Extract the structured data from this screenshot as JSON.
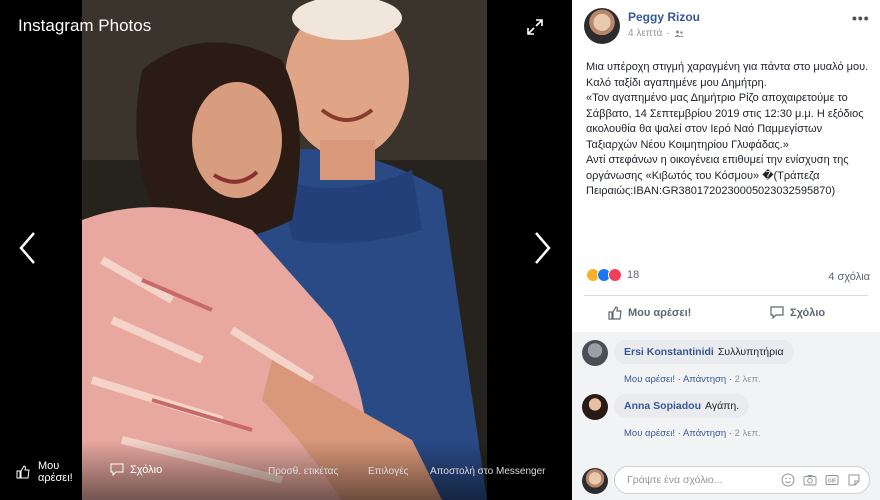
{
  "viewer": {
    "title": "Instagram Photos",
    "bottom": {
      "like_label": "Μου αρέσει!",
      "comment_label": "Σχόλιο",
      "links": [
        "Προσθ. ετικέτας",
        "Επιλογές",
        "Αποστολή στο Messenger"
      ]
    }
  },
  "post": {
    "author": "Peggy Rizou",
    "time": "4 λεπτά",
    "text_lines": [
      "Μια υπέροχη στιγμή χαραγμένη για πάντα στο μυαλό μου.",
      "Καλό ταξίδι αγαπημένε μου Δημήτρη.",
      "«Τον αγαπημένο μας Δημήτριο Ρίζο αποχαιρετούμε το Σάββατο, 14 Σεπτεμβρίου 2019 στις 12:30 μ.μ. Η εξόδιος ακολουθία θα ψαλεί στον Ιερό Ναό Παμμεγίστων Ταξιαρχών Νέου Κοιμητηρίου Γλυφάδας.»",
      "Αντί στεφάνων η οικογένεια επιθυμεί την ενίσχυση της οργάνωσης «Κιβωτός του Κόσμου» �(Τράπεζα Πειραιώς:IBAN:GR3801720230005023032595870)"
    ],
    "reaction_count": "18",
    "comments_count": "4 σχόλια",
    "actions": {
      "like": "Μου αρέσει!",
      "comment": "Σχόλιο"
    }
  },
  "comments": [
    {
      "name": "Ersi Konstantinidi",
      "text": "Συλλυπητήρια",
      "like": "Μου αρέσει!",
      "reply": "Απάντηση",
      "time": "2 λεπ."
    },
    {
      "name": "Anna Sopiadou",
      "text": "Αγάπη.",
      "like": "Μου αρέσει!",
      "reply": "Απάντηση",
      "time": "2 λεπ."
    }
  ],
  "reply": {
    "placeholder": "Γράψτε ένα σχόλιο..."
  },
  "colors": {
    "link": "#365899",
    "like_blue": "#1877f2",
    "love_red": "#f33e58",
    "sad_yellow": "#f7b125"
  }
}
